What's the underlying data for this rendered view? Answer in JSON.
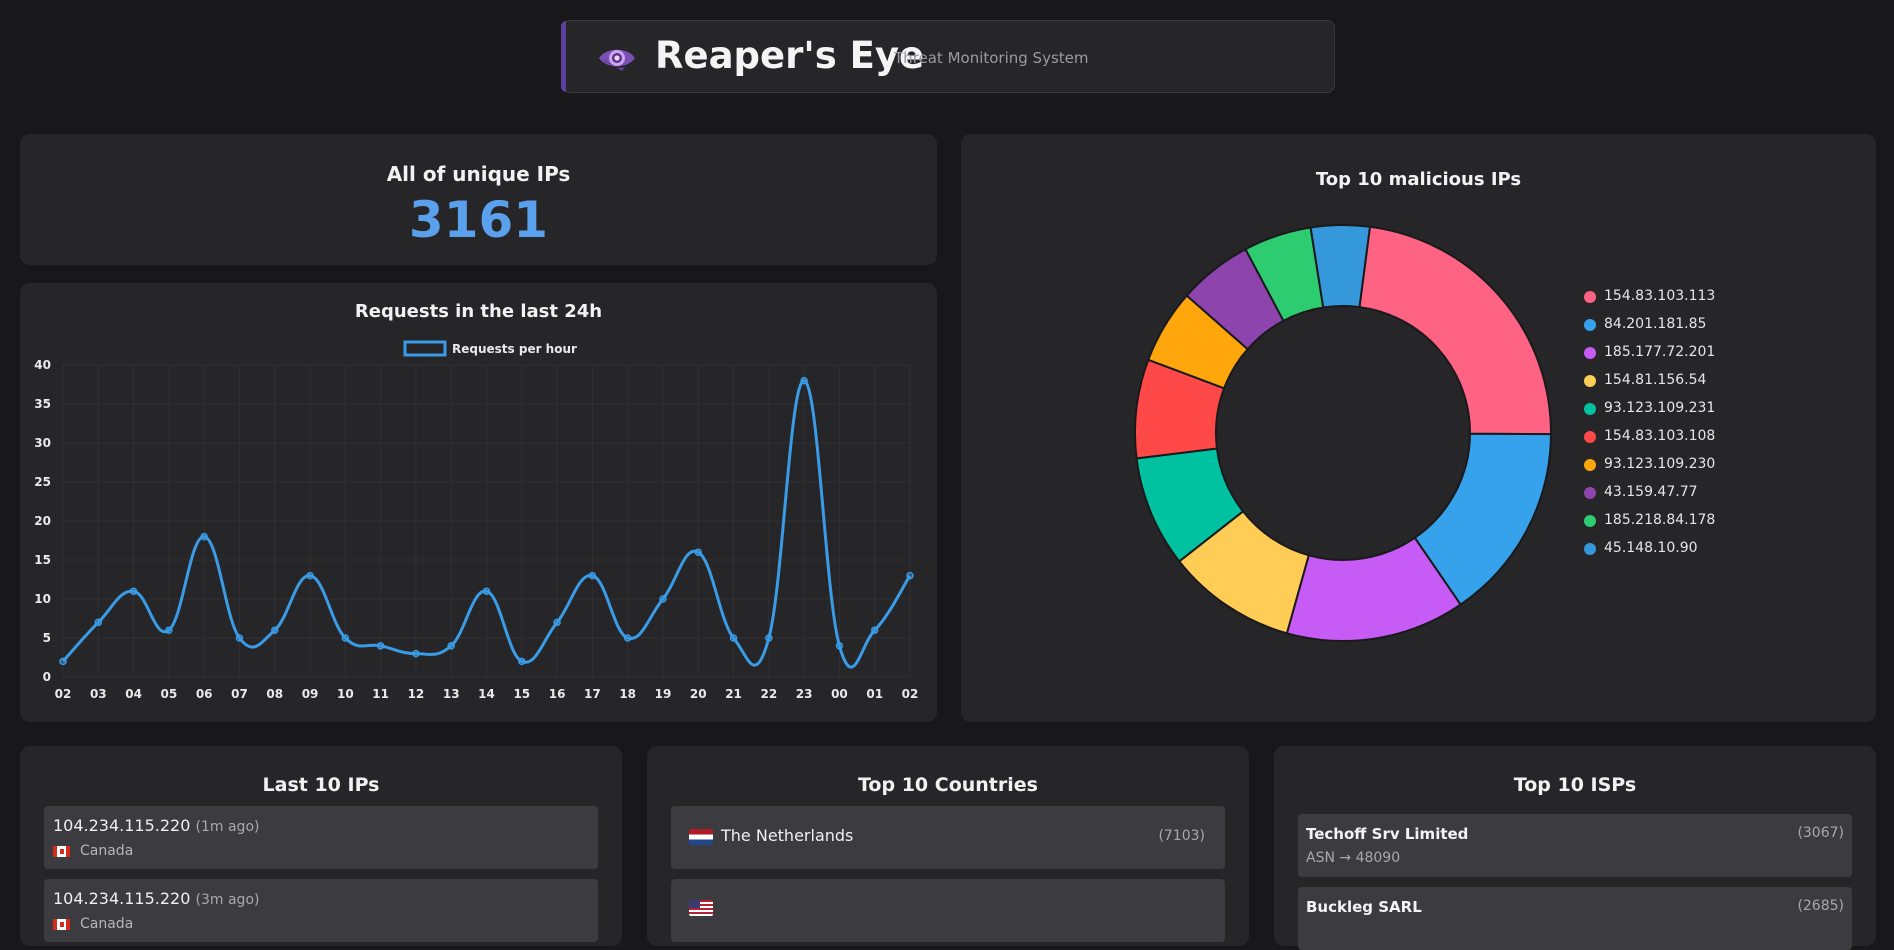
{
  "header": {
    "title": "Reaper's Eye",
    "subtitle": "Threat Monitoring System",
    "icon": "eye-icon",
    "accent_color": "#5b3fa0"
  },
  "unique_ips": {
    "title": "All of unique IPs",
    "value": "3161",
    "value_color": "#5aa0ec"
  },
  "requests_chart": {
    "title": "Requests in the last 24h",
    "chart_data": {
      "type": "line",
      "title": "Requests in the last 24h",
      "categories": [
        "02",
        "03",
        "04",
        "05",
        "06",
        "07",
        "08",
        "09",
        "10",
        "11",
        "12",
        "13",
        "14",
        "15",
        "16",
        "17",
        "18",
        "19",
        "20",
        "21",
        "22",
        "23",
        "00",
        "01",
        "02"
      ],
      "series": [
        {
          "name": "Requests per hour",
          "color": "#3a9be6",
          "values": [
            2,
            7,
            11,
            6,
            18,
            5,
            6,
            13,
            5,
            4,
            3,
            4,
            11,
            2,
            7,
            13,
            5,
            10,
            16,
            5,
            5,
            38,
            4,
            6,
            13
          ]
        }
      ],
      "yticks": [
        "0",
        "5",
        "10",
        "15",
        "20",
        "25",
        "30",
        "35",
        "40"
      ],
      "ylim": [
        0,
        40
      ],
      "grid": true,
      "legend": "top"
    }
  },
  "malicious_chart": {
    "title": "Top 10 malicious IPs",
    "chart_data": {
      "type": "pie",
      "title": "Top 10 malicious IPs",
      "donut": true,
      "legend": "right",
      "labels": [
        "154.83.103.113",
        "84.201.181.85",
        "185.177.72.201",
        "154.81.156.54",
        "93.123.109.231",
        "154.83.103.108",
        "93.123.109.230",
        "43.159.47.77",
        "185.218.84.178",
        "45.148.10.90"
      ],
      "values": [
        96,
        64,
        58,
        42,
        36,
        32,
        24,
        24,
        22,
        19
      ],
      "colors": [
        "#ff6384",
        "#36a2eb",
        "#c65cf5",
        "#ffcd56",
        "#00c2a0",
        "#ff4848",
        "#ffa60c",
        "#8e44ad",
        "#2ecc71",
        "#3498db"
      ]
    }
  },
  "last_ips": {
    "title": "Last 10 IPs",
    "items": [
      {
        "ip": "104.234.115.220",
        "ago": "(1m ago)",
        "country": "Canada"
      },
      {
        "ip": "104.234.115.220",
        "ago": "(3m ago)",
        "country": "Canada"
      }
    ]
  },
  "top_countries": {
    "title": "Top 10 Countries",
    "items": [
      {
        "name": "The Netherlands",
        "count": "(7103)"
      }
    ]
  },
  "top_isps": {
    "title": "Top 10 ISPs",
    "items": [
      {
        "name": "Techoff Srv Limited",
        "count": "(3067)",
        "asn": "ASN → 48090"
      },
      {
        "name": "Buckleg SARL",
        "count": "(2685)"
      }
    ]
  }
}
